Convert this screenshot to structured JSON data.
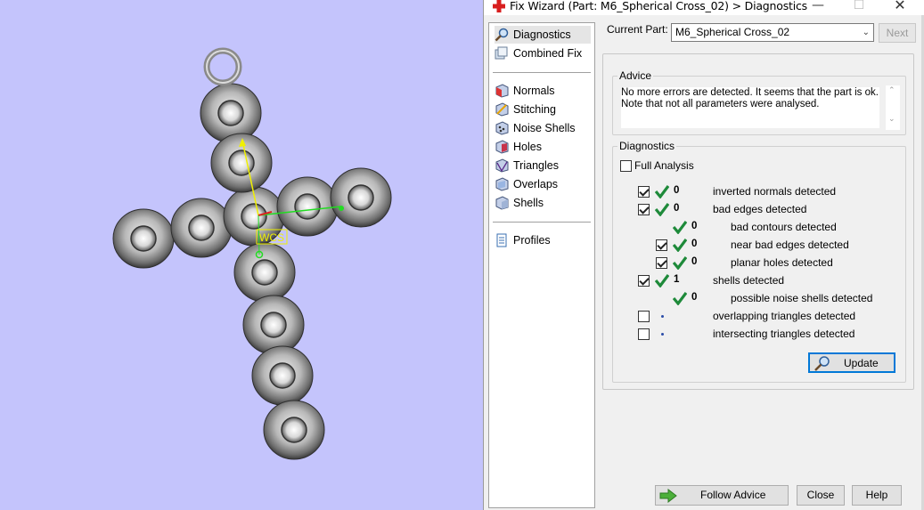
{
  "window": {
    "title": "Fix Wizard (Part: M6_Spherical Cross_02) > Diagnostics",
    "minimize": "—",
    "maximize": "☐",
    "close": "✕"
  },
  "viewport": {
    "background": "#c4c4fc",
    "wcs_label": "WCS"
  },
  "nav": {
    "items": [
      {
        "label": "Diagnostics",
        "icon": "magnifier-icon",
        "selected": true
      },
      {
        "label": "Combined Fix",
        "icon": "combined-fix-icon"
      },
      {
        "label": "Normals",
        "icon": "normals-icon"
      },
      {
        "label": "Stitching",
        "icon": "stitching-icon"
      },
      {
        "label": "Noise Shells",
        "icon": "noise-shells-icon"
      },
      {
        "label": "Holes",
        "icon": "holes-icon"
      },
      {
        "label": "Triangles",
        "icon": "triangles-icon"
      },
      {
        "label": "Overlaps",
        "icon": "overlaps-icon"
      },
      {
        "label": "Shells",
        "icon": "shells-icon"
      },
      {
        "label": "Profiles",
        "icon": "document-icon"
      }
    ]
  },
  "current_part": {
    "label": "Current Part:",
    "value": "M6_Spherical Cross_02",
    "next_label": "Next"
  },
  "advice": {
    "title": "Advice",
    "line1": "No more errors are detected. It seems that the part is ok.",
    "line2": "Note that not all parameters were analysed."
  },
  "diagnostics": {
    "title": "Diagnostics",
    "full_analysis": "Full Analysis",
    "rows": [
      {
        "count": "0",
        "label": "inverted normals detected"
      },
      {
        "count": "0",
        "label": "bad edges detected"
      },
      {
        "count": "0",
        "label": "bad contours detected"
      },
      {
        "count": "0",
        "label": "near bad edges detected"
      },
      {
        "count": "0",
        "label": "planar holes detected"
      },
      {
        "count": "1",
        "label": "shells detected"
      },
      {
        "count": "0",
        "label": "possible noise shells detected"
      },
      {
        "count": "",
        "label": "overlapping triangles detected"
      },
      {
        "count": "",
        "label": "intersecting triangles detected"
      }
    ],
    "update_label": "Update"
  },
  "footer": {
    "follow_advice": "Follow Advice",
    "close": "Close",
    "help": "Help"
  },
  "colors": {
    "check_green": "#1e8a3a",
    "accent_blue": "#0078d7",
    "title_icon_red": "#d81e1e"
  }
}
